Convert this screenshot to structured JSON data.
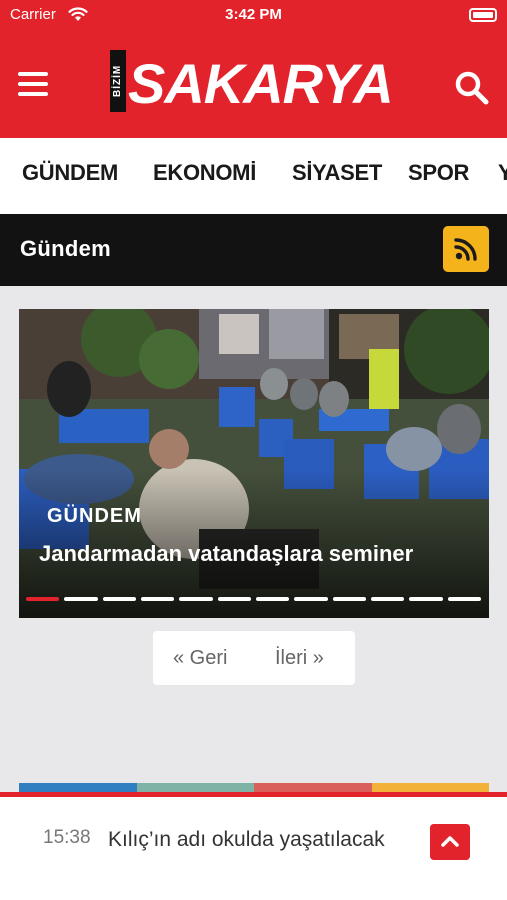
{
  "status_bar": {
    "carrier": "Carrier",
    "time": "3:42 PM"
  },
  "header": {
    "logo_small": "BİZİM",
    "logo_main": "SAKARYA",
    "menu_icon": "hamburger-menu-icon",
    "search_icon": "search-icon",
    "brand_color": "#e3232b"
  },
  "categories": [
    "GÜNDEM",
    "EKONOMİ",
    "SİYASET",
    "SPOR",
    "Y"
  ],
  "section": {
    "title": "Gündem",
    "rss_icon": "rss-icon",
    "rss_color": "#f4b21b"
  },
  "slider": {
    "category": "GÜNDEM",
    "headline": "Jandarmadan vatandaşlara seminer",
    "total_slides": 12,
    "active_slide": 1
  },
  "pager": {
    "prev_label": "« Geri",
    "next_label": "İleri »"
  },
  "ticker": {
    "time": "15:38",
    "text": "Kılıç’ın adı okulda yaşatılacak",
    "up_icon": "chevron-up-icon",
    "stripe_colors": [
      "#2f7fc1",
      "#7fb3a6",
      "#d9605a",
      "#f2b23a"
    ]
  }
}
